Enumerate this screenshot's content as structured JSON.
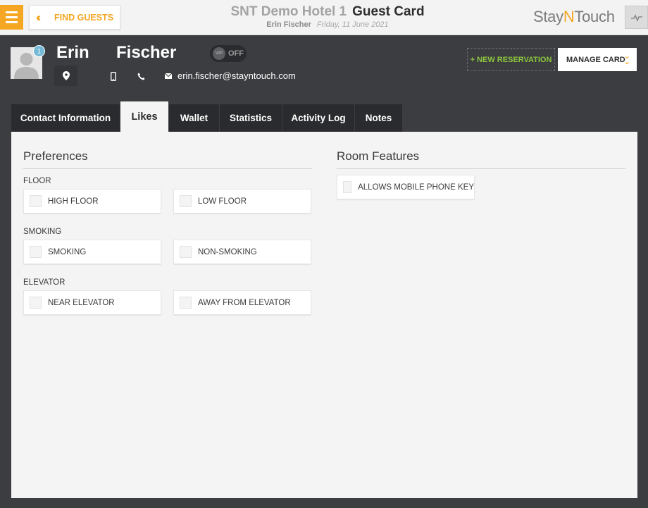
{
  "topbar": {
    "find_guests_label": "FIND GUESTS",
    "hotel_name": "SNT Demo Hotel 1",
    "page_title": "Guest Card",
    "guest_name": "Erin Fischer",
    "date": "Friday, 11 June 2021",
    "logo": {
      "part1": "Stay",
      "part2": "N",
      "part3": "Touch"
    }
  },
  "guest": {
    "first_name": "Erin",
    "last_name": "Fischer",
    "badge_count": "1",
    "vip_knob": "VIP",
    "vip_state": "OFF",
    "email": "erin.fischer@stayntouch.com"
  },
  "actions": {
    "new_reservation": "+ NEW RESERVATION",
    "manage_card": "MANAGE CARD"
  },
  "tabs": [
    {
      "label": "Contact Information",
      "active": false
    },
    {
      "label": "Likes",
      "active": true
    },
    {
      "label": "Wallet",
      "active": false
    },
    {
      "label": "Statistics",
      "active": false
    },
    {
      "label": "Activity Log",
      "active": false
    },
    {
      "label": "Notes",
      "active": false
    }
  ],
  "preferences": {
    "title": "Preferences",
    "groups": [
      {
        "label": "FLOOR",
        "options": [
          "HIGH FLOOR",
          "LOW FLOOR"
        ]
      },
      {
        "label": "SMOKING",
        "options": [
          "SMOKING",
          "NON-SMOKING"
        ]
      },
      {
        "label": "ELEVATOR",
        "options": [
          "NEAR ELEVATOR",
          "AWAY FROM ELEVATOR"
        ]
      }
    ]
  },
  "room_features": {
    "title": "Room Features",
    "options": [
      "ALLOWS MOBILE PHONE KEY"
    ]
  },
  "colors": {
    "accent": "#f5a623",
    "header_bg": "#3b3d40",
    "new_reservation": "#8dc63f",
    "badge": "#73b9d6"
  },
  "icons": [
    "menu-icon",
    "double-chevron-left-icon",
    "activity-icon",
    "avatar-silhouette-icon",
    "location-pin-icon",
    "mobile-phone-icon",
    "phone-icon",
    "email-icon",
    "double-chevron-down-icon",
    "checkbox-icon"
  ]
}
